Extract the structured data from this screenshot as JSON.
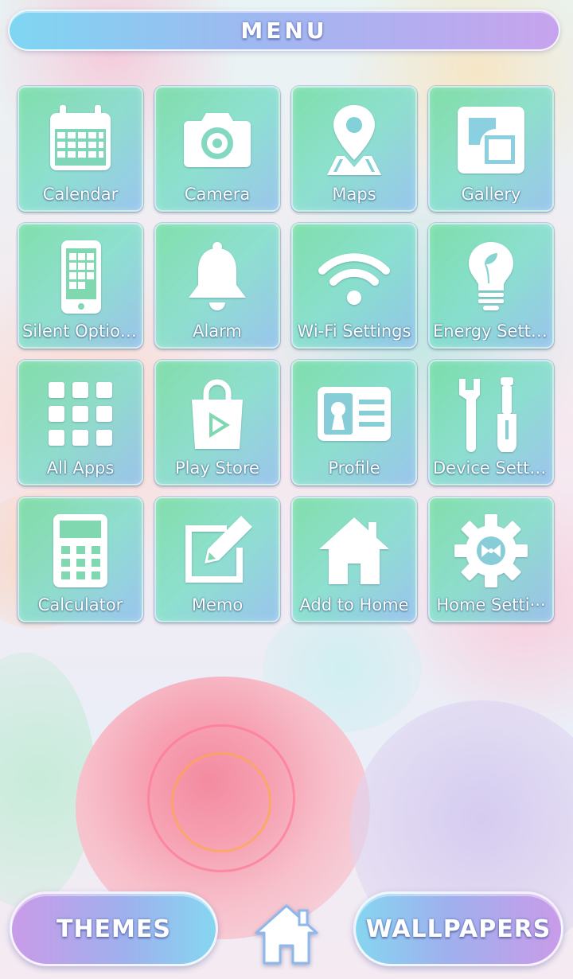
{
  "header": {
    "title": "MENU"
  },
  "tiles": [
    {
      "label": "Calendar",
      "icon": "calendar-icon"
    },
    {
      "label": "Camera",
      "icon": "camera-icon"
    },
    {
      "label": "Maps",
      "icon": "map-pin-icon"
    },
    {
      "label": "Gallery",
      "icon": "gallery-icon"
    },
    {
      "label": "Silent Options",
      "icon": "phone-icon"
    },
    {
      "label": "Alarm",
      "icon": "bell-icon"
    },
    {
      "label": "Wi-Fi Settings",
      "icon": "wifi-icon"
    },
    {
      "label": "Energy Setti···",
      "icon": "lightbulb-icon"
    },
    {
      "label": "All Apps",
      "icon": "app-grid-icon"
    },
    {
      "label": "Play Store",
      "icon": "play-store-bag-icon"
    },
    {
      "label": "Profile",
      "icon": "id-card-icon"
    },
    {
      "label": "Device Setti···",
      "icon": "tools-icon"
    },
    {
      "label": "Calculator",
      "icon": "calculator-icon"
    },
    {
      "label": "Memo",
      "icon": "memo-pencil-icon"
    },
    {
      "label": "Add to Home",
      "icon": "home-icon"
    },
    {
      "label": "Home Setti···",
      "icon": "gear-icon"
    }
  ],
  "bottom": {
    "themes_label": "THEMES",
    "wallpapers_label": "WALLPAPERS",
    "home_icon": "home-icon"
  },
  "colors": {
    "tile_green": "#6edca0",
    "tile_blue": "#8cbeeb",
    "header_left": "#7fd6f2",
    "header_right": "#c7a3ee"
  }
}
